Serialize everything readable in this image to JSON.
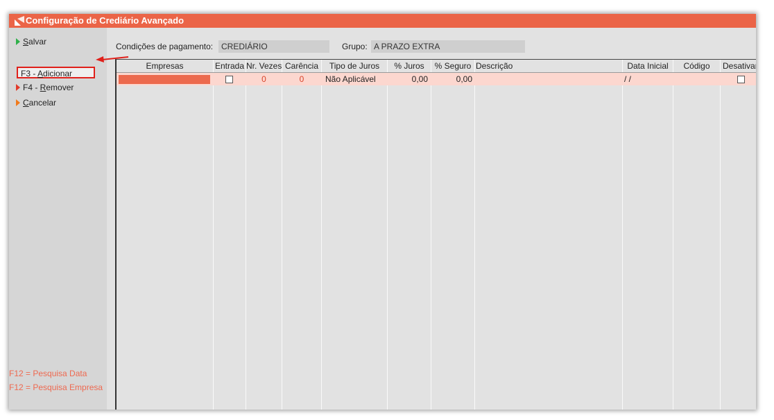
{
  "window": {
    "title": "Configuração de Crediário Avançado",
    "accent_color": "#eb6447"
  },
  "sidebar": {
    "items": [
      {
        "key": "S",
        "rest": "alvar",
        "prefix": "",
        "icon": "green-arrow-icon"
      },
      {
        "key": "A",
        "rest": "dicionar",
        "prefix": "F3 - ",
        "icon": ""
      },
      {
        "key": "R",
        "rest": "emover",
        "prefix": "F4 - ",
        "icon": "red-arrow-icon"
      },
      {
        "key": "C",
        "rest": "ancelar",
        "prefix": "",
        "icon": "orange-arrow-icon"
      }
    ],
    "hints": [
      "F12 = Pesquisa Data",
      "F12 = Pesquisa Empresa"
    ]
  },
  "form": {
    "condicoes_label": "Condições de pagamento:",
    "condicoes_value": "CREDIÁRIO",
    "grupo_label": "Grupo:",
    "grupo_value": "A PRAZO EXTRA"
  },
  "grid": {
    "columns": [
      "Empresas",
      "Entrada",
      "Nr. Vezes",
      "Carência",
      "Tipo de Juros",
      "% Juros",
      "% Seguro",
      "Descrição",
      "Data Inicial",
      "Código",
      "Desativar"
    ],
    "rows": [
      {
        "empresas": "",
        "entrada": false,
        "nr_vezes": "0",
        "carencia": "0",
        "tipo_juros": "Não Aplicável",
        "juros": "0,00",
        "seguro": "0,00",
        "descricao": "",
        "data_inicial": "/ /",
        "codigo": "",
        "desativar": false
      }
    ]
  }
}
